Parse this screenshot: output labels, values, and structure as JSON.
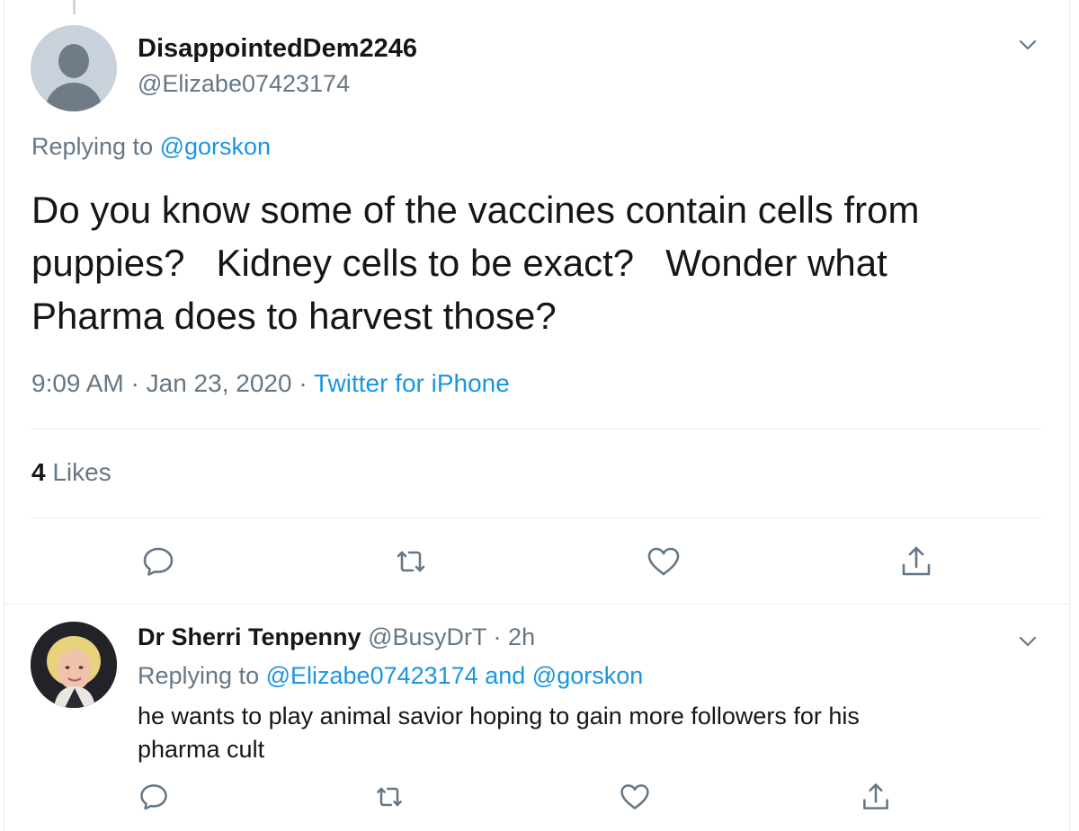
{
  "tweet": {
    "display_name": "DisappointedDem2246",
    "handle": "@Elizabe07423174",
    "replying_prefix": "Replying to",
    "replying_to": "@gorskon",
    "text_lines": [
      "Do you know some of the vaccines contain cells from",
      "puppies?   Kidney cells to be exact?   Wonder what",
      "Pharma does to harvest those?"
    ],
    "time": "9:09 AM",
    "date": "Jan 23, 2020",
    "separator": "·",
    "source": "Twitter for iPhone",
    "likes_count": "4",
    "likes_label": "Likes"
  },
  "reply": {
    "display_name": "Dr Sherri Tenpenny",
    "handle": "@BusyDrT",
    "separator": "·",
    "time_ago": "2h",
    "replying_prefix": "Replying to",
    "replying_to_1": "@Elizabe07423174",
    "replying_and": "and",
    "replying_to_2": "@gorskon",
    "text_lines": [
      "he wants to play animal savior hoping to gain more followers for his",
      "pharma cult"
    ]
  },
  "icons": {
    "more": "chevron-down-icon",
    "reply": "reply-icon",
    "retweet": "retweet-icon",
    "like": "heart-icon",
    "share": "share-icon"
  },
  "colors": {
    "text": "#14171a",
    "secondary": "#657786",
    "link": "#1b95e0",
    "divider": "#e6ecf0"
  }
}
